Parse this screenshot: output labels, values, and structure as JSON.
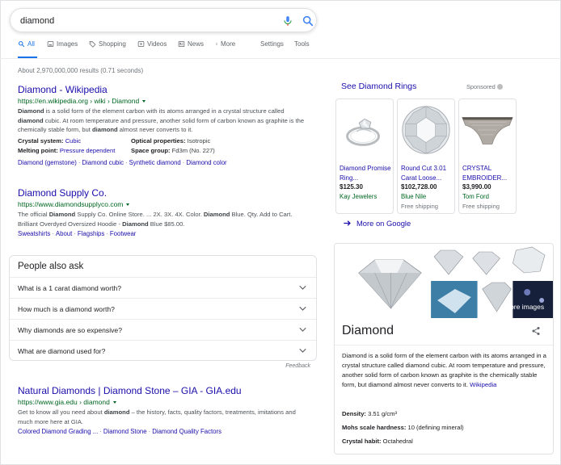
{
  "search": {
    "query": "diamond"
  },
  "tabs": [
    {
      "label": "All",
      "icon": "search-icon",
      "active": true
    },
    {
      "label": "Images",
      "icon": "image-icon"
    },
    {
      "label": "Shopping",
      "icon": "tag-icon"
    },
    {
      "label": "Videos",
      "icon": "video-icon"
    },
    {
      "label": "News",
      "icon": "news-icon"
    },
    {
      "label": "More",
      "icon": "more-dots-icon"
    }
  ],
  "settings_label": "Settings",
  "tools_label": "Tools",
  "result_stats": "About 2,970,000,000 results (0.71 seconds)",
  "results": [
    {
      "title": "Diamond - Wikipedia",
      "url": "https://en.wikipedia.org › wiki › Diamond",
      "snippet_parts": [
        "Diamond",
        " is a solid form of the element carbon with its atoms arranged in a crystal structure called ",
        "diamond",
        " cubic. At room temperature and pressure, another solid form of carbon known as graphite is the chemically stable form, but ",
        "diamond",
        " almost never converts to it."
      ],
      "facts": [
        {
          "label": "Crystal system:",
          "value": "Cubic",
          "link": true
        },
        {
          "label": "Optical properties:",
          "value": "Isotropic",
          "link": false
        },
        {
          "label": "Melting point:",
          "value": "Pressure dependent",
          "link": true
        },
        {
          "label": "Space group:",
          "value": "Fd3m (No. 227)",
          "link": false
        }
      ],
      "sitelinks": [
        "Diamond (gemstone)",
        "Diamond cubic",
        "Synthetic diamond",
        "Diamond color"
      ]
    },
    {
      "title": "Diamond Supply Co.",
      "url": "https://www.diamondsupplyco.com",
      "snippet_parts": [
        "The official ",
        "Diamond",
        " Supply Co. Online Store. ... 2X. 3X. 4X. Color. ",
        "Diamond",
        " Blue. Qty. Add to Cart. Brilliant Overdyed Oversized Hoodie - ",
        "Diamond",
        " Blue $85.00."
      ],
      "sitelinks": [
        "Sweatshirts",
        "About",
        "Flagships",
        "Footwear"
      ]
    },
    {
      "title": "Natural Diamonds | Diamond Stone – GIA - GIA.edu",
      "url": "https://www.gia.edu › diamond",
      "snippet_parts": [
        "Get to know all you need about ",
        "diamond",
        " – the history, facts, quality factors, treatments, imitations and much more here at GIA."
      ],
      "sitelinks": [
        "Colored Diamond Grading ...",
        "Diamond Stone",
        "Diamond Quality Factors"
      ]
    }
  ],
  "people_also_ask": {
    "title": "People also ask",
    "questions": [
      "What is a 1 carat diamond worth?",
      "How much is a diamond worth?",
      "Why diamonds are so expensive?",
      "What are diamond used for?"
    ],
    "feedback": "Feedback"
  },
  "shopping": {
    "heading": "See Diamond Rings",
    "sponsored": "Sponsored",
    "products": [
      {
        "title": "Diamond Promise Ring...",
        "price": "$125.30",
        "seller": "Kay Jewelers",
        "shipping": ""
      },
      {
        "title": "Round Cut 3.01 Carat Loose...",
        "price": "$102,728.00",
        "seller": "Blue Nile",
        "shipping": "Free shipping"
      },
      {
        "title": "CRYSTAL EMBROIDER...",
        "price": "$3,990.00",
        "seller": "Tom Ford",
        "shipping": "Free shipping"
      }
    ],
    "more_label": "More on Google"
  },
  "knowledge_panel": {
    "more_images": "More images",
    "title": "Diamond",
    "description": "Diamond is a solid form of the element carbon with its atoms arranged in a crystal structure called diamond cubic. At room temperature and pressure, another solid form of carbon known as graphite is the chemically stable form, but diamond almost never converts to it.",
    "source": "Wikipedia",
    "facts": [
      {
        "label": "Density:",
        "value": "3.51 g/cm³"
      },
      {
        "label": "Mohs scale hardness:",
        "value": "10 (defining mineral)"
      },
      {
        "label": "Crystal habit:",
        "value": "Octahedral"
      }
    ]
  },
  "colors": {
    "link": "#1a0dab",
    "url": "#006621",
    "accent": "#1a73e8",
    "text": "#202124",
    "muted": "#70757a"
  }
}
